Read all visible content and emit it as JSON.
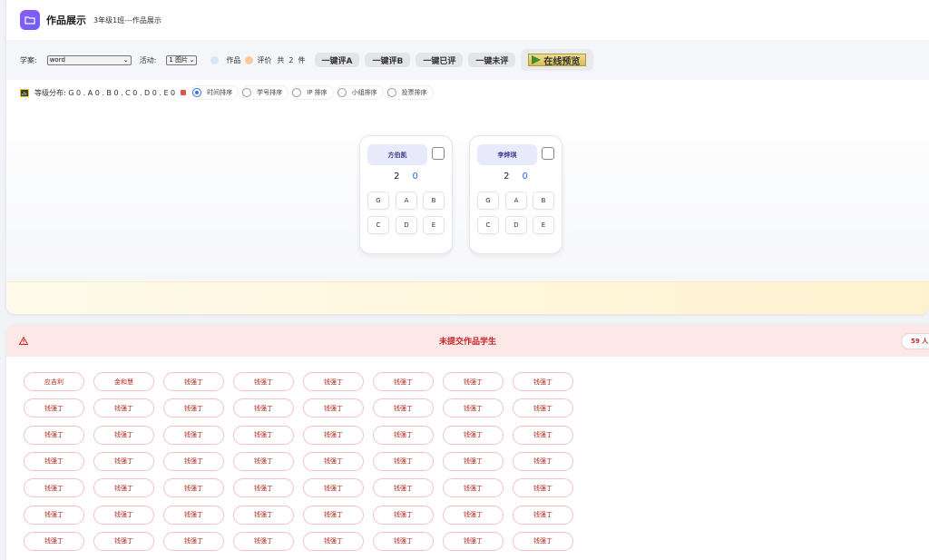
{
  "header": {
    "title": "作品展示",
    "subtitle": "3年级1班---作品展示"
  },
  "toolbar": {
    "case_label": "学案:",
    "case_value": "word",
    "activity_label": "活动:",
    "activity_value": "1 图片",
    "works_label": "作品",
    "review_label": "评价",
    "total_prefix": "共",
    "total_count": "2",
    "total_suffix": "件",
    "btn_rate_a": "一键评A",
    "btn_rate_b": "一键评B",
    "btn_reviewed": "一键已评",
    "btn_unreviewed": "一键未评",
    "btn_preview": "在线预览",
    "colors": {
      "works_dot": "#d6e4fb",
      "review_dot": "#f8c99a"
    }
  },
  "sortbar": {
    "grade_dist": "等级分布: G 0 . A 0 . B 0 . C 0 . D 0 . E 0",
    "options": [
      "时间排序",
      "学号排序",
      "IP 排序",
      "小组排序",
      "投票排序"
    ],
    "selected": "时间排序"
  },
  "cards": [
    {
      "name": "方伯凯",
      "score_a": "2",
      "score_b": "0"
    },
    {
      "name": "李烨琪",
      "score_a": "2",
      "score_b": "0"
    }
  ],
  "grades": [
    "G",
    "A",
    "B",
    "C",
    "D",
    "E"
  ],
  "missing": {
    "title": "未提交作品学生",
    "count": "59 人",
    "students": [
      "应吉利",
      "金和慧",
      "钱强丁",
      "钱强丁",
      "钱强丁",
      "钱强丁",
      "钱强丁",
      "钱强丁",
      "钱强丁",
      "钱强丁",
      "钱强丁",
      "钱强丁",
      "钱强丁",
      "钱强丁",
      "钱强丁",
      "钱强丁",
      "钱强丁",
      "钱强丁",
      "钱强丁",
      "钱强丁",
      "钱强丁",
      "钱强丁",
      "钱强丁",
      "钱强丁",
      "钱强丁",
      "钱强丁",
      "钱强丁",
      "钱强丁",
      "钱强丁",
      "钱强丁",
      "钱强丁",
      "钱强丁",
      "钱强丁",
      "钱强丁",
      "钱强丁",
      "钱强丁",
      "钱强丁",
      "钱强丁",
      "钱强丁",
      "钱强丁",
      "钱强丁",
      "钱强丁",
      "钱强丁",
      "钱强丁",
      "钱强丁",
      "钱强丁",
      "钱强丁",
      "钱强丁",
      "钱强丁",
      "钱强丁",
      "钱强丁",
      "钱强丁",
      "钱强丁",
      "钱强丁",
      "钱强丁",
      "钱强丁"
    ]
  }
}
